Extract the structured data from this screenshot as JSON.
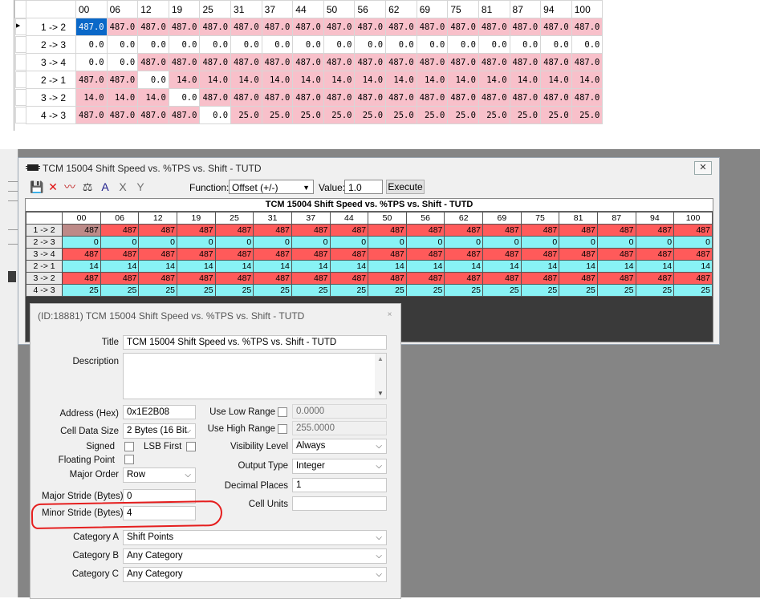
{
  "top_grid": {
    "columns": [
      "00",
      "06",
      "12",
      "19",
      "25",
      "31",
      "37",
      "44",
      "50",
      "56",
      "62",
      "69",
      "75",
      "81",
      "87",
      "94",
      "100"
    ],
    "rows": [
      {
        "label": "1 -> 2",
        "values": [
          "487.0",
          "487.0",
          "487.0",
          "487.0",
          "487.0",
          "487.0",
          "487.0",
          "487.0",
          "487.0",
          "487.0",
          "487.0",
          "487.0",
          "487.0",
          "487.0",
          "487.0",
          "487.0",
          "487.0"
        ]
      },
      {
        "label": "2 -> 3",
        "values": [
          "0.0",
          "0.0",
          "0.0",
          "0.0",
          "0.0",
          "0.0",
          "0.0",
          "0.0",
          "0.0",
          "0.0",
          "0.0",
          "0.0",
          "0.0",
          "0.0",
          "0.0",
          "0.0",
          "0.0"
        ]
      },
      {
        "label": "3 -> 4",
        "values": [
          "0.0",
          "0.0",
          "487.0",
          "487.0",
          "487.0",
          "487.0",
          "487.0",
          "487.0",
          "487.0",
          "487.0",
          "487.0",
          "487.0",
          "487.0",
          "487.0",
          "487.0",
          "487.0",
          "487.0"
        ]
      },
      {
        "label": "2 -> 1",
        "values": [
          "487.0",
          "487.0",
          "0.0",
          "14.0",
          "14.0",
          "14.0",
          "14.0",
          "14.0",
          "14.0",
          "14.0",
          "14.0",
          "14.0",
          "14.0",
          "14.0",
          "14.0",
          "14.0",
          "14.0"
        ]
      },
      {
        "label": "3 -> 2",
        "values": [
          "14.0",
          "14.0",
          "14.0",
          "0.0",
          "487.0",
          "487.0",
          "487.0",
          "487.0",
          "487.0",
          "487.0",
          "487.0",
          "487.0",
          "487.0",
          "487.0",
          "487.0",
          "487.0",
          "487.0"
        ]
      },
      {
        "label": "4 -> 3",
        "values": [
          "487.0",
          "487.0",
          "487.0",
          "487.0",
          "0.0",
          "25.0",
          "25.0",
          "25.0",
          "25.0",
          "25.0",
          "25.0",
          "25.0",
          "25.0",
          "25.0",
          "25.0",
          "25.0",
          "25.0"
        ]
      }
    ],
    "row_marker": "▸",
    "highlight_color": "#f8c0ca",
    "selected_color": "#0a68c8"
  },
  "table_window": {
    "title": "TCM 15004 Shift Speed vs. %TPS vs. Shift - TUTD",
    "close_glyph": "✕",
    "toolbar": {
      "icons": [
        "save-icon",
        "delete-icon",
        "graph-icon",
        "scale-icon",
        "text-icon",
        "clear-icon",
        "split-icon"
      ],
      "glyphs": [
        "💾",
        "✕",
        "〰",
        "⚖",
        "A",
        "X",
        "Y"
      ],
      "function_label": "Function:",
      "function_value": "Offset (+/-)",
      "value_label": "Value:",
      "value": "1.0",
      "execute_label": "Execute"
    },
    "grid_title": "TCM 15004 Shift Speed vs. %TPS vs. Shift - TUTD",
    "columns": [
      "00",
      "06",
      "12",
      "19",
      "25",
      "31",
      "37",
      "44",
      "50",
      "56",
      "62",
      "69",
      "75",
      "81",
      "87",
      "94",
      "100"
    ],
    "rows": [
      {
        "label": "1 -> 2",
        "value": "487",
        "kind": "red"
      },
      {
        "label": "2 -> 3",
        "value": "0",
        "kind": "cyan"
      },
      {
        "label": "3 -> 4",
        "value": "487",
        "kind": "red"
      },
      {
        "label": "2 -> 1",
        "value": "14",
        "kind": "cyan"
      },
      {
        "label": "3 -> 2",
        "value": "487",
        "kind": "red"
      },
      {
        "label": "4 -> 3",
        "value": "25",
        "kind": "cyan"
      }
    ],
    "colors": {
      "red": "#ff5a5a",
      "cyan": "#88f2f5",
      "first": "#bd8a88"
    }
  },
  "props": {
    "title": "(ID:18881) TCM 15004 Shift Speed vs. %TPS vs. Shift - TUTD",
    "close_glyph": "×",
    "title_label": "Title",
    "title_value": "TCM 15004 Shift Speed vs. %TPS vs. Shift - TUTD",
    "description_label": "Description",
    "address_label": "Address (Hex)",
    "address_value": "0x1E2B08",
    "cell_size_label": "Cell Data Size",
    "cell_size_value": "2 Bytes (16 Bit",
    "signed_label": "Signed",
    "lsb_label": "LSB First",
    "floating_label": "Floating Point",
    "major_order_label": "Major Order",
    "major_order_value": "Row",
    "major_stride_label": "Major Stride (Bytes)",
    "major_stride_value": "0",
    "minor_stride_label": "Minor Stride (Bytes)",
    "minor_stride_value": "4",
    "use_low_label": "Use Low Range",
    "use_low_value": "0.0000",
    "use_high_label": "Use High Range",
    "use_high_value": "255.0000",
    "visibility_label": "Visibility Level",
    "visibility_value": "Always",
    "output_label": "Output Type",
    "output_value": "Integer",
    "decimal_label": "Decimal Places",
    "decimal_value": "1",
    "units_label": "Cell Units",
    "units_value": "",
    "cat_a_label": "Category A",
    "cat_a_value": "Shift Points",
    "cat_b_label": "Category B",
    "cat_b_value": "Any Category",
    "cat_c_label": "Category C",
    "cat_c_value": "Any Category"
  }
}
